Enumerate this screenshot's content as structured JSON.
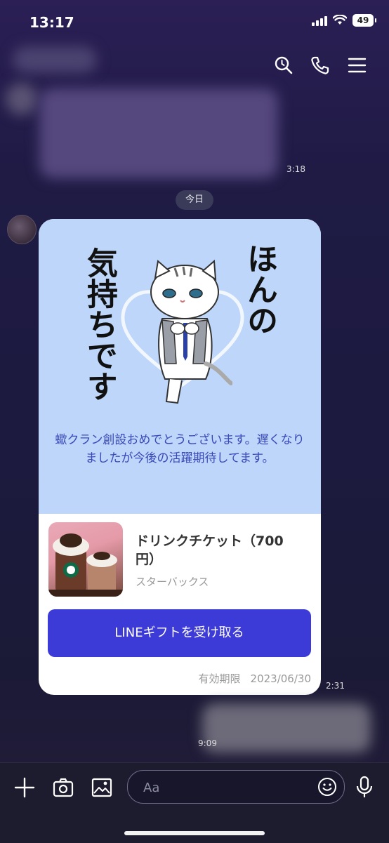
{
  "status_bar": {
    "time": "13:17",
    "battery": "49"
  },
  "chat": {
    "prev_message_time": "3:18",
    "date_divider": "今日",
    "gift_message": {
      "sticker_text_left": "気持ちです",
      "sticker_text_right": "ほんの",
      "message": "蠍クラン創設おめでとうございます。遅くなりましたが今後の活躍期待してます。",
      "product_name": "ドリンクチケット（700円）",
      "product_brand": "スターバックス",
      "button_label": "LINEギフトを受け取る",
      "expiry_label": "有効期限",
      "expiry_date": "2023/06/30",
      "time": "2:31"
    },
    "last_message_time": "9:09"
  },
  "input_bar": {
    "placeholder": "Aa"
  },
  "colors": {
    "accent_button": "#3d3bd8",
    "card_top": "#bdd6f9",
    "message_text": "#3a49b8"
  },
  "icons": [
    "search-icon",
    "phone-icon",
    "menu-icon",
    "plus-icon",
    "camera-icon",
    "image-icon",
    "emoji-icon",
    "mic-icon"
  ]
}
